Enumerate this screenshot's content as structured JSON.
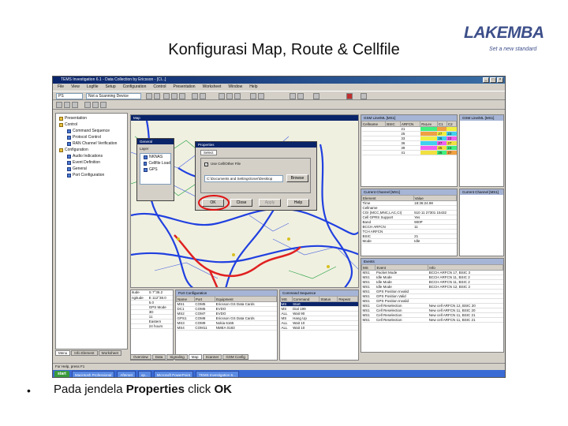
{
  "slide": {
    "title": "Konfigurasi Map, Route & Cellfile",
    "logo_word": "LAKEMBA",
    "logo_tagline": "Set a new standard",
    "bullet": "•",
    "caption_prefix": "Pada jendela ",
    "caption_bold1": "Properties",
    "caption_mid": " click ",
    "caption_bold2": "OK"
  },
  "app": {
    "title": "TEMS Investigation 6.1 - Data Collection by Ericsson - [Cl...]",
    "menu": [
      "File",
      "View",
      "Logfile",
      "Setup",
      "Configuration",
      "Control",
      "Presentation",
      "Worksheet",
      "Window",
      "Help"
    ],
    "combo_port": "PS",
    "combo_device": "Not a Scanning Device"
  },
  "navigator": {
    "items": [
      "Presentation",
      "Control",
      "Command Sequence",
      "Protocol Control",
      "RAN Channel Verification",
      "Configuration",
      "Audio Indications",
      "Event Definition",
      "General",
      "Port Configuration"
    ],
    "tabs": [
      "Menu",
      "Info Element",
      "Worksheet"
    ]
  },
  "map": {
    "title": "Map",
    "colors": {
      "road": "#2040e0",
      "route": "#e02020",
      "green": "#20a040",
      "yellow": "#d8c020"
    }
  },
  "layer_dialog": {
    "title": "General",
    "field": "Layer",
    "layers": [
      "NKNAS",
      "Cellfile Load",
      "GPS"
    ]
  },
  "properties_dialog": {
    "title": "Properties",
    "tab": "Select",
    "checkbox_label": "Use Cell/Other File",
    "path_value": "C:\\Documents and Settings\\User\\Desktop",
    "browse": "Browse",
    "ok": "OK",
    "close": "Close",
    "apply": "Apply",
    "help": "Help"
  },
  "gsm_line": {
    "title": "GSM Line/ML [MS1]",
    "columns": [
      "Cellname",
      "BSIC",
      "ARFCN",
      "RxLev",
      "C1",
      "C2"
    ],
    "rows": [
      [
        "",
        "",
        "21",
        "",
        "",
        ""
      ],
      [
        "",
        "",
        "25",
        "",
        "27",
        "23"
      ],
      [
        "",
        "",
        "33",
        "",
        "26",
        "22"
      ],
      [
        "",
        "",
        "36",
        "",
        "27",
        "27"
      ],
      [
        "",
        "",
        "39",
        "",
        "25",
        "23"
      ],
      [
        "",
        "",
        "41",
        "",
        "26",
        "27"
      ]
    ]
  },
  "current_channel": {
    "title": "Current Channel [MS1]",
    "columns": [
      "Element",
      "Value"
    ],
    "rows": [
      [
        "Time",
        "18:36:24.98"
      ],
      [
        "Cellname",
        ""
      ],
      [
        "CGI (MCC,MNC,LAC,CI)",
        "510 11 27301 15432"
      ],
      [
        "Cell GPRS Support",
        "Yes"
      ],
      [
        "Band",
        "900P"
      ],
      [
        "BCCH ARFCN",
        "11"
      ],
      [
        "TCH ARFCN",
        ""
      ],
      [
        "BSIC",
        "21"
      ],
      [
        "Mode",
        "Idle"
      ]
    ]
  },
  "events": {
    "title": "Events",
    "columns": [
      "MS",
      "Event",
      "Info"
    ],
    "rows": [
      [
        "MS1",
        "Packet Mode",
        "BCCH ARFCN 17, BSIC 3"
      ],
      [
        "MS1",
        "Idle Mode",
        "BCCH ARFCN 11, BSIC 2"
      ],
      [
        "MS1",
        "Idle Mode",
        "BCCH ARFCN 11, BSIC 2"
      ],
      [
        "MS1",
        "Idle Mode",
        "BCCH ARFCN 12, BSIC 2"
      ],
      [
        "MS1",
        "GPS Position Invalid",
        ""
      ],
      [
        "MS1",
        "GPS Position Valid",
        ""
      ],
      [
        "MS1",
        "GPS Position Invalid",
        ""
      ],
      [
        "MS1",
        "Cell Reselection",
        "New cell ARFCN 12, BSIC 20"
      ],
      [
        "MS1",
        "Cell Reselection",
        "New cell ARFCN 11, BSIC 20"
      ],
      [
        "MS1",
        "Cell Reselection",
        "New cell ARFCN 11, BSIC 21"
      ],
      [
        "MS1",
        "Cell Reselection",
        "New cell ARFCN 11, BSIC 21"
      ]
    ]
  },
  "port_config": {
    "title": "Port Configuration",
    "columns": [
      "Name",
      "Port",
      "Equipment"
    ],
    "rows": [
      [
        "MS1",
        "COM5",
        "Ericsson GS Data Cards"
      ],
      [
        "DC1",
        "COM6",
        "EVDO"
      ],
      [
        "MS2",
        "COM7",
        "EVDO"
      ],
      [
        "GPS1",
        "COM8",
        "Ericsson GS Data Cards"
      ],
      [
        "MS3",
        "COM9",
        "Nokia 6165"
      ],
      [
        "MS4",
        "COM11",
        "NMEA 0183"
      ]
    ]
  },
  "gps_panel": {
    "rows": [
      [
        "itude",
        "S 7°36.2"
      ],
      [
        "ngitude",
        "E 112°38.0"
      ],
      [
        "",
        "5.0"
      ],
      [
        "",
        "GPS Mode"
      ],
      [
        "",
        "3D"
      ],
      [
        "",
        "11"
      ],
      [
        "",
        "Eastern"
      ],
      [
        "",
        "24 hours"
      ]
    ]
  },
  "command_seq": {
    "title": "Command Sequence",
    "columns": [
      "MS",
      "Command",
      "Status",
      "Repeat"
    ],
    "rows": [
      [
        "MS",
        "Start",
        "",
        ""
      ],
      [
        "MS",
        "Dial 199",
        "",
        ""
      ],
      [
        "ALL",
        "Wait 90",
        "",
        ""
      ],
      [
        "MS",
        "Hang Up",
        "",
        ""
      ],
      [
        "ALL",
        "Wait 10",
        "",
        ""
      ],
      [
        "ALL",
        "Wait 10",
        "",
        ""
      ]
    ]
  },
  "bottom_tabs": [
    "Overview",
    "Data",
    "Signaling",
    "Map",
    "Scanner",
    "GSM Config"
  ],
  "status_text": "For Help, press F1",
  "taskbar": {
    "start": "start",
    "tasks": [
      "Macintosh Professional",
      "Afterset",
      "op...",
      "Microsoft PowerPoint",
      "TEMS Investigation 6..."
    ]
  }
}
